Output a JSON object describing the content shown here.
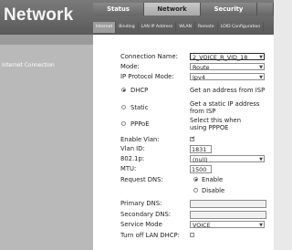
{
  "brand": "Network",
  "main_tabs": [
    "Status",
    "Network",
    "Security",
    ""
  ],
  "sub_tabs": [
    "Internet",
    "Binding",
    "LAN IP Address",
    "WLAN",
    "Remote",
    "LOID Configuration"
  ],
  "sidebar": {
    "item": "Internet Connection"
  },
  "form": {
    "connection_name": {
      "label": "Connection Name:",
      "value": "2_VOICE_R_VID_18"
    },
    "mode": {
      "label": "Mode:",
      "value": "Route"
    },
    "ip_protocol_mode": {
      "label": "IP Protocol Mode:",
      "value": "Ipv4"
    },
    "dhcp": {
      "label": "DHCP",
      "desc": "Get an address from ISP"
    },
    "static": {
      "label": "Static",
      "desc": "Get a static IP address from ISP"
    },
    "pppoe": {
      "label": "PPPoE",
      "desc": "Select this when using PPPOE"
    },
    "enable_vlan": {
      "label": "Enable Vlan:"
    },
    "vlan_id": {
      "label": "Vlan ID:",
      "value": "1831"
    },
    "dot1p": {
      "label": "802.1p:",
      "value": "(null)"
    },
    "mtu": {
      "label": "MTU:",
      "value": "1500"
    },
    "request_dns": {
      "label": "Request DNS:",
      "enable": "Enable",
      "disable": "Disable"
    },
    "primary_dns": {
      "label": "Primary DNS:",
      "value": ""
    },
    "secondary_dns": {
      "label": "Secondary DNS:",
      "value": ""
    },
    "service_mode": {
      "label": "Service Mode",
      "value": "VOICE"
    },
    "turn_off_lan_dhcp": {
      "label": "Turn off LAN DHCP:"
    }
  }
}
